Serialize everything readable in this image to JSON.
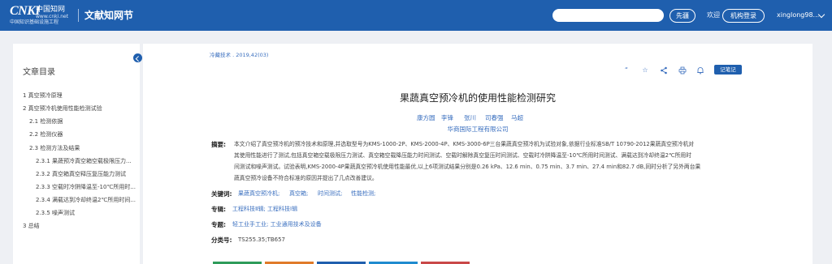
{
  "header": {
    "logo_main": "CNKI",
    "logo_cn": "中国知网",
    "logo_url": "www.cnki.net",
    "logo_sub": "中国知识基础设施工程",
    "site_title": "文献知网节",
    "search_placeholder": "",
    "search_button": "先疆",
    "welcome": "欢迎",
    "login_button": "机构登录",
    "username": "xinglong98..."
  },
  "sidebar": {
    "title": "文章目录",
    "items": [
      "1 真空预冷原理",
      "2 真空预冷机使用性能检测试验",
      "2.1 检测依据",
      "2.2 检测仪器",
      "2.3 检测方法及结果",
      "2.3.1 果蔬预冷真空箱空载极限压力...",
      "2.3.2 真空箱真空释压复压能力测试",
      "2.3.3 空载时冷阱降温至-10℃所用时...",
      "2.3.4 满载达到冷却终温2℃所用时间...",
      "2.3.5 噪声测试",
      "3 总结"
    ]
  },
  "article": {
    "source": "冷藏技术 . 2019,42(03)",
    "tool_icons": [
      "quote-icon",
      "star-icon",
      "share-icon",
      "print-icon",
      "bell-icon"
    ],
    "note_button": "记笔记",
    "title": "果蔬真空预冷机的使用性能检测研究",
    "authors": [
      "康方圆",
      "李锋",
      "张川",
      "司春强",
      "马超"
    ],
    "organization": "华商国际工程有限公司",
    "abstract_label": "摘要:",
    "abstract_lines": [
      "本文介绍了真空预冷机的预冷技术和原理,并选取型号为KMS-1000-2P、KMS-2000-4P、KMS-3000-6P三台果蔬真空预冷机为试验对象,依据行业标准SB/T 10790-2012果蔬真空预冷机对",
      "其使用性能进行了测试,包括真空箱空载极限压力测试、真空箱空载降压能力时间测试、空载时解除真空复压时间测试、空载时冷阱降温至-10℃所用时间测试、满载达到冷却终温2℃所用时",
      "间测试和噪声测试。试验表明,KMS-2000-4P果蔬真空预冷机使用性能最优,以上6项测试结果分别是0.26 kPa、12.6 min、0.75 min、3.7 min、27.4 min和82.7 dB,同时分析了另外两台果",
      "蔬真空预冷设备不符合标准的原因并提出了几点改善建议。"
    ],
    "keywords_label": "关键词:",
    "keywords": [
      "果蔬真空预冷机;",
      "真空箱;",
      "时间测试;",
      "性能检测;"
    ],
    "series_label": "专辑:",
    "series": "工程科技Ⅱ辑; 工程科技Ⅰ辑",
    "topic_label": "专题:",
    "topic": "轻工业手工业; 工业通用技术及设备",
    "class_label": "分类号:",
    "class_number": "TS255.35;TB657"
  },
  "colors": {
    "header_bg": "#1f5fae",
    "link": "#3a6fbf",
    "page_bg": "#eef0f4"
  }
}
